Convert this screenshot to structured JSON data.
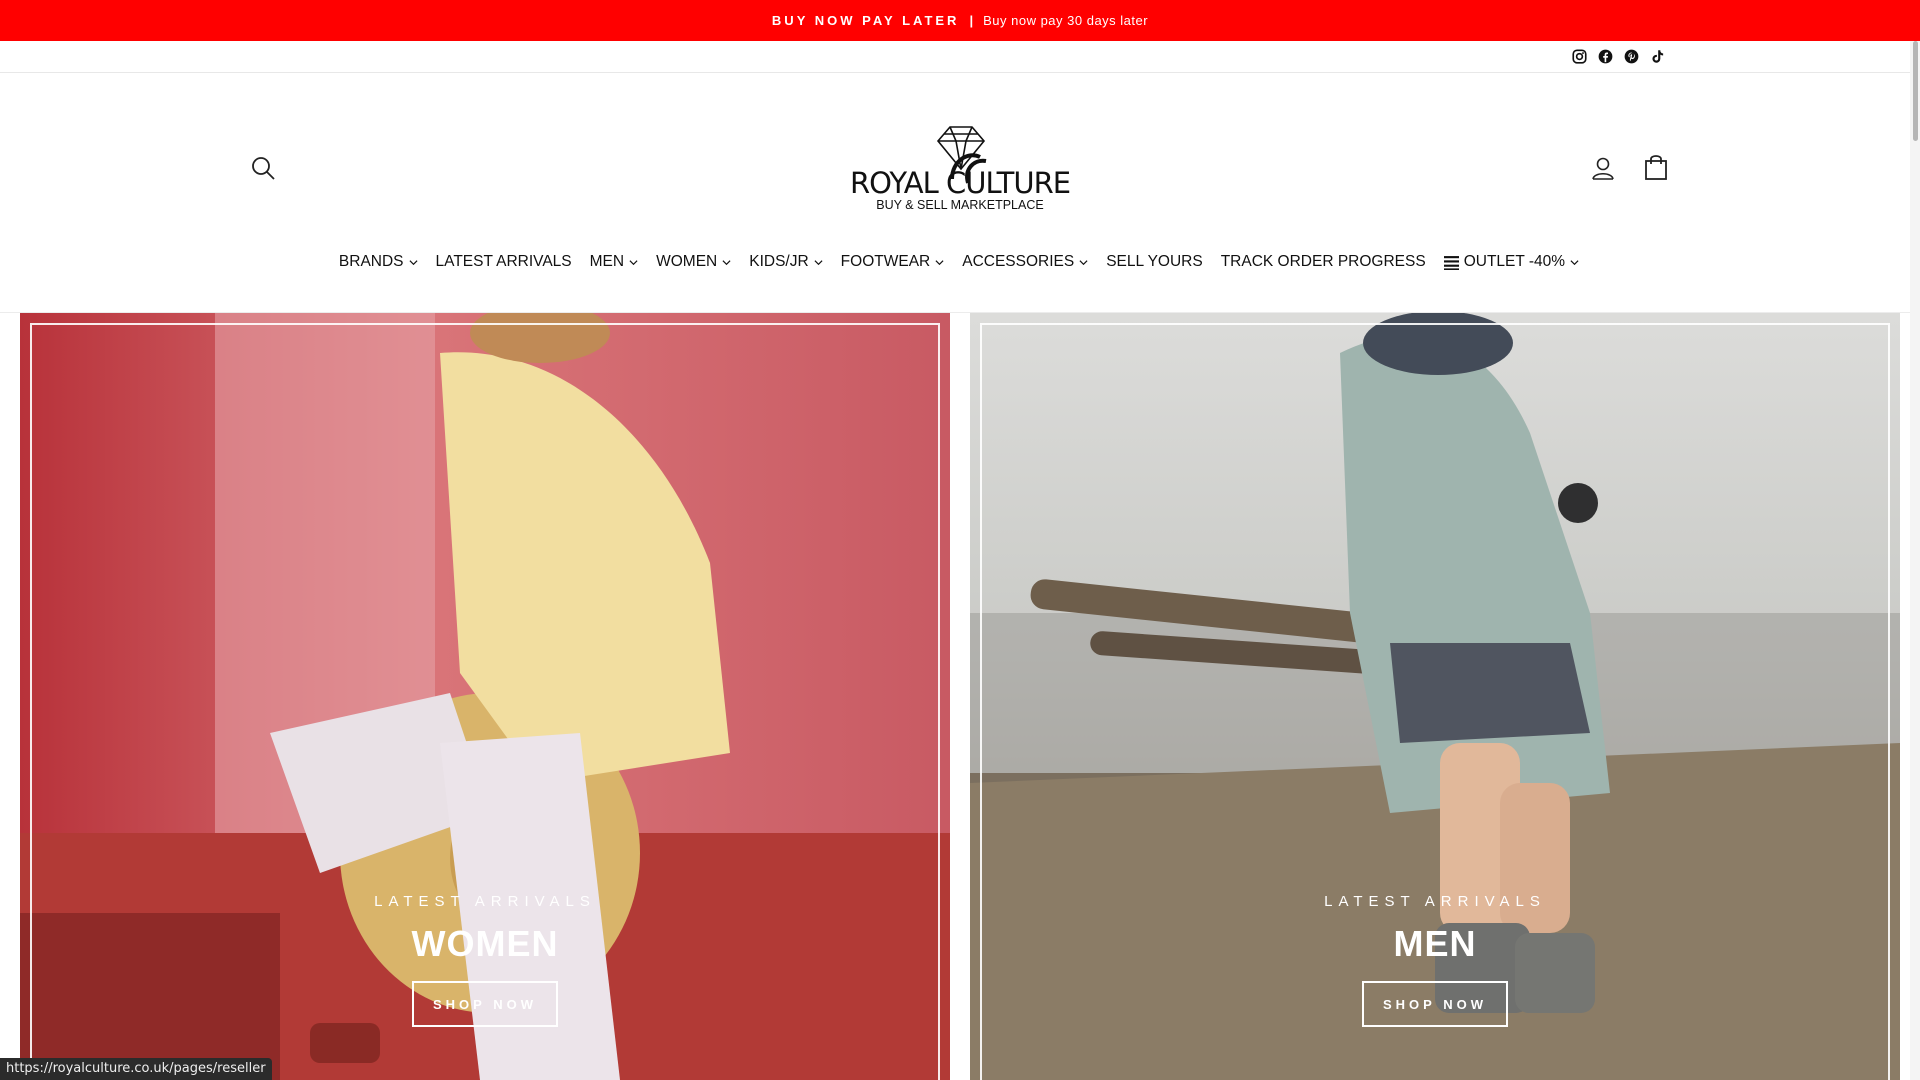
{
  "announcement": {
    "strong": "BUY NOW PAY LATER",
    "separator": "|",
    "note": "Buy now pay 30 days later"
  },
  "social": [
    "instagram-icon",
    "facebook-icon",
    "pinterest-icon",
    "tiktok-icon"
  ],
  "header": {
    "logo_text": "ROYAL CULTURE",
    "logo_tagline": "BUY & SELL MARKETPLACE"
  },
  "nav": {
    "brands": "BRANDS",
    "latest": "LATEST ARRIVALS",
    "men": "MEN",
    "women": "WOMEN",
    "kids": "KIDS/JR",
    "footwear": "FOOTWEAR",
    "accessories": "ACCESSORIES",
    "sell": "SELL YOURS",
    "track": "TRACK ORDER PROGRESS",
    "outlet": "OUTLET -40%"
  },
  "tiles": {
    "women": {
      "subtitle": "LATEST ARRIVALS",
      "title": "WOMEN",
      "button": "SHOP NOW"
    },
    "men": {
      "subtitle": "LATEST ARRIVALS",
      "title": "MEN",
      "button": "SHOP NOW"
    }
  },
  "status_url": "https://royalculture.co.uk/pages/reseller",
  "colors": {
    "announcement_bg": "#ff0000",
    "text": "#111111"
  }
}
